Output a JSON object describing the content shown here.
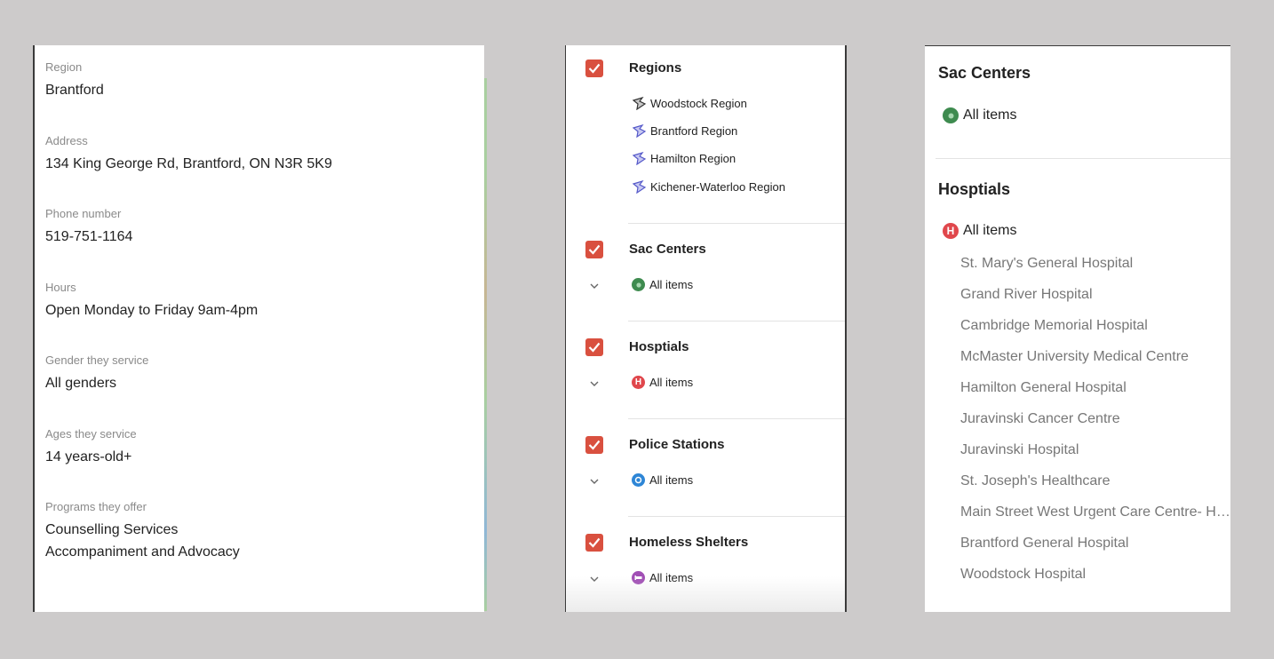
{
  "details": {
    "fields": [
      {
        "label": "Region",
        "value": "Brantford"
      },
      {
        "label": "Address",
        "value": "134 King George Rd, Brantford, ON N3R 5K9"
      },
      {
        "label": "Phone number",
        "value": "519-751-1164"
      },
      {
        "label": "Hours",
        "value": "Open Monday to Friday 9am-4pm"
      },
      {
        "label": "Gender they service",
        "value": "All genders"
      },
      {
        "label": "Ages they service",
        "value": "14 years-old+"
      },
      {
        "label": "Programs they offer",
        "value": "Counselling Services",
        "value2": "Accompaniment and Advocacy"
      }
    ]
  },
  "layers": {
    "regions": {
      "title": "Regions",
      "items": [
        "Woodstock Region",
        "Brantford Region",
        "Hamilton Region",
        "Kichener-Waterloo Region"
      ]
    },
    "groups": [
      {
        "title": "Sac Centers",
        "item": "All items",
        "color": "#3e8b4f"
      },
      {
        "title": "Hosptials",
        "item": "All items",
        "color": "#e0474c"
      },
      {
        "title": "Police Stations",
        "item": "All items",
        "color": "#2e86d6"
      },
      {
        "title": "Homeless Shelters",
        "item": "All items",
        "color": "#a14fb5"
      }
    ],
    "checkbox_color": "#d9503f"
  },
  "list": {
    "sac": {
      "title": "Sac Centers",
      "item": "All items"
    },
    "hospitals": {
      "title": "Hosptials",
      "item": "All items",
      "entries": [
        "St. Mary's General Hospital",
        "Grand River Hospital",
        "Cambridge Memorial Hospital",
        "McMaster University Medical Centre",
        "Hamilton General Hospital",
        "Juravinski Cancer Centre",
        "Juravinski Hospital",
        "St. Joseph's Healthcare",
        "Main Street West Urgent Care Centre- Ha...",
        "Brantford General Hospital",
        "Woodstock Hospital"
      ]
    }
  }
}
